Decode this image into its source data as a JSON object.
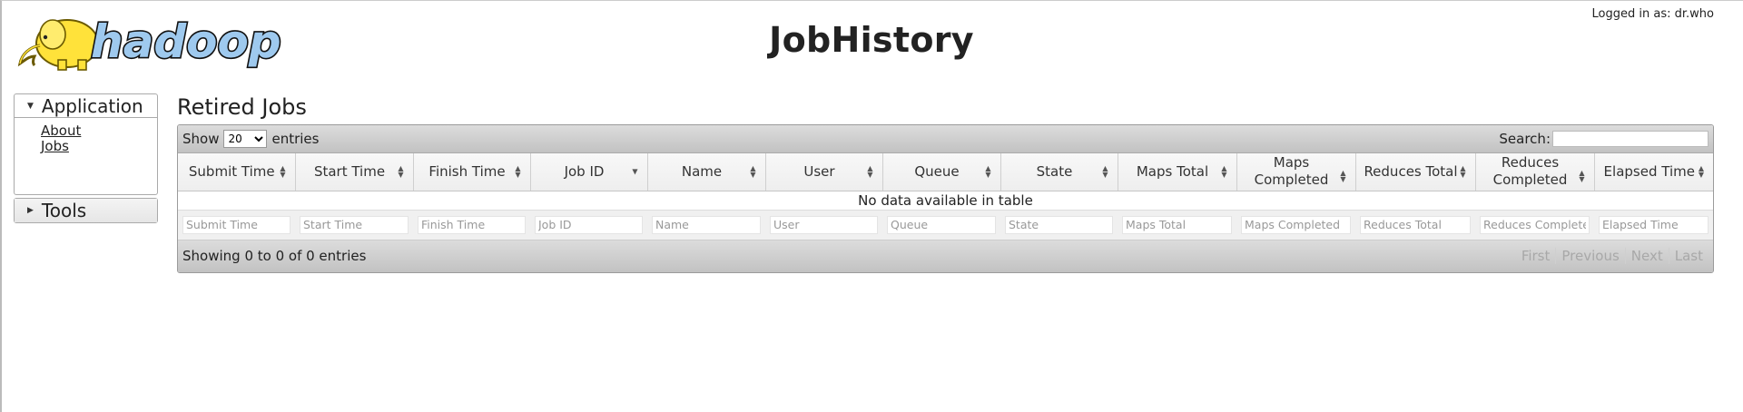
{
  "header": {
    "title": "JobHistory",
    "logged_in": "Logged in as: dr.who",
    "logo_text": "hadoop"
  },
  "sidebar": {
    "sections": [
      {
        "label": "Application",
        "expanded": true,
        "items": [
          {
            "label": "About"
          },
          {
            "label": "Jobs"
          }
        ]
      },
      {
        "label": "Tools",
        "expanded": false,
        "items": []
      }
    ]
  },
  "main": {
    "title": "Retired Jobs",
    "toolbar": {
      "show_label": "Show",
      "entries_label": "entries",
      "page_size": "20",
      "page_size_options": [
        "20"
      ],
      "search_label": "Search:",
      "search_value": ""
    },
    "columns": [
      {
        "label": "Submit Time",
        "filter_placeholder": "Submit Time"
      },
      {
        "label": "Start Time",
        "filter_placeholder": "Start Time"
      },
      {
        "label": "Finish Time",
        "filter_placeholder": "Finish Time"
      },
      {
        "label": "Job ID",
        "filter_placeholder": "Job ID",
        "sorted": "desc"
      },
      {
        "label": "Name",
        "filter_placeholder": "Name"
      },
      {
        "label": "User",
        "filter_placeholder": "User"
      },
      {
        "label": "Queue",
        "filter_placeholder": "Queue"
      },
      {
        "label": "State",
        "filter_placeholder": "State"
      },
      {
        "label": "Maps Total",
        "filter_placeholder": "Maps Total"
      },
      {
        "label": "Maps Completed",
        "filter_placeholder": "Maps Completed"
      },
      {
        "label": "Reduces Total",
        "filter_placeholder": "Reduces Total"
      },
      {
        "label": "Reduces Completed",
        "filter_placeholder": "Reduces Completed"
      },
      {
        "label": "Elapsed Time",
        "filter_placeholder": "Elapsed Time"
      }
    ],
    "empty_message": "No data available in table",
    "info": "Showing 0 to 0 of 0 entries",
    "pagination": {
      "first": "First",
      "previous": "Previous",
      "next": "Next",
      "last": "Last"
    }
  },
  "colors": {
    "toolbar_top": "#dcdcdc",
    "toolbar_bottom": "#c2c2c2",
    "elephant_yellow": "#ffe23a",
    "logo_blue": "#9ec9ee"
  }
}
